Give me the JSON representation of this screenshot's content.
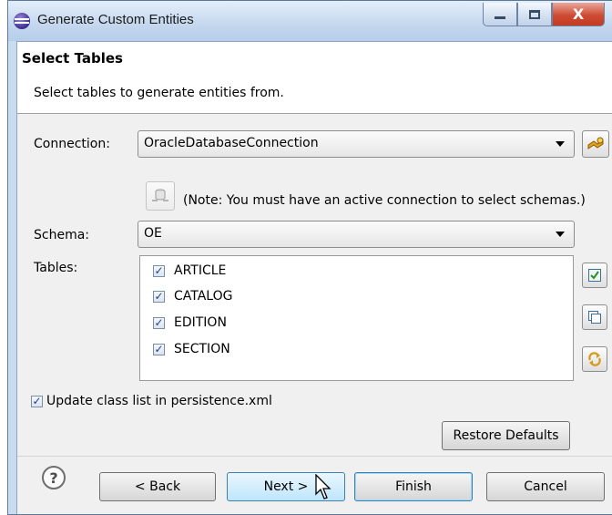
{
  "window": {
    "title": "Generate Custom Entities",
    "controls": {
      "close_glyph": "X"
    }
  },
  "header": {
    "title": "Select Tables",
    "description": "Select tables to generate entities from."
  },
  "form": {
    "connection_label": "Connection:",
    "connection_value": "OracleDatabaseConnection",
    "connect_icon": "database-connect-icon",
    "note": "(Note: You must have an active connection to select schemas.)",
    "schema_label": "Schema:",
    "schema_value": "OE",
    "tables_label": "Tables:",
    "tables": [
      {
        "label": "ARTICLE",
        "checked": true
      },
      {
        "label": "CATALOG",
        "checked": true
      },
      {
        "label": "EDITION",
        "checked": true
      },
      {
        "label": "SECTION",
        "checked": true
      }
    ],
    "update_checkbox_label": "Update class list in persistence.xml",
    "update_checked": true,
    "restore_defaults_label": "Restore Defaults"
  },
  "footer": {
    "help_glyph": "?",
    "back_label": "< Back",
    "next_label": "Next >",
    "finish_label": "Finish",
    "cancel_label": "Cancel"
  },
  "colors": {
    "title_bar": "#c4d7ee",
    "close_button": "#cf4b33",
    "dialog_background": "#f0f0f0",
    "focus_blue": "#3c7fb1"
  }
}
